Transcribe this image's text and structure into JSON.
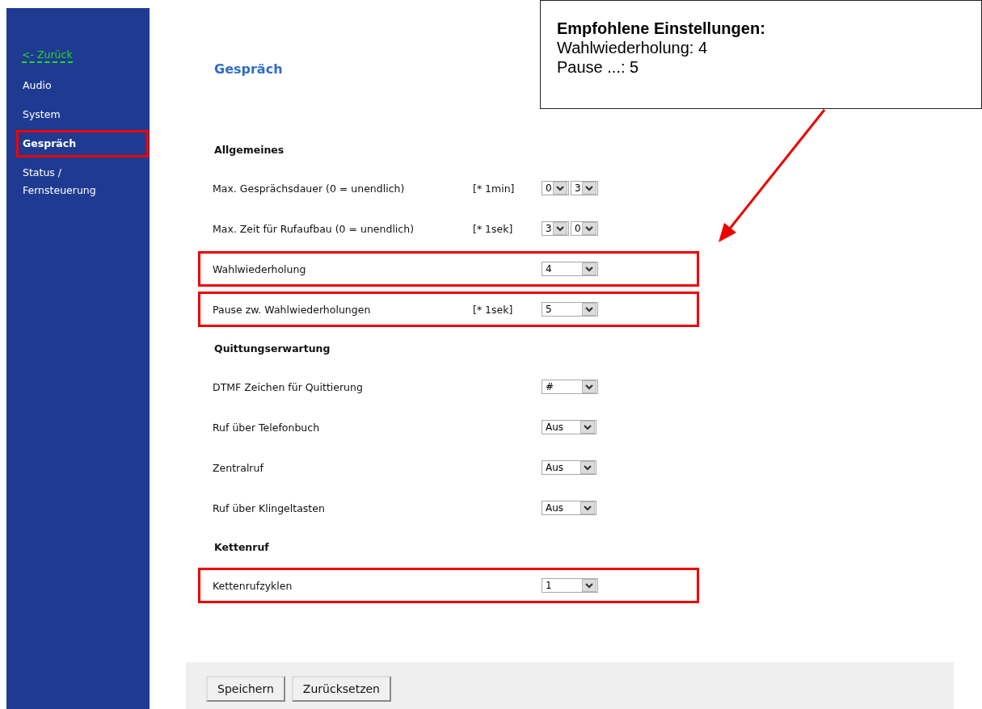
{
  "sidebar": {
    "back_link": "<- Zurück",
    "items": [
      {
        "label": "Audio",
        "selected": false,
        "highlighted": false
      },
      {
        "label": "System",
        "selected": false,
        "highlighted": false
      },
      {
        "label": "Gespräch",
        "selected": true,
        "highlighted": true
      },
      {
        "label": "Status /\nFernsteuerung",
        "selected": false,
        "highlighted": false
      }
    ]
  },
  "page_title": "Gespräch",
  "sections": [
    {
      "title": "Allgemeines",
      "rows": [
        {
          "label": "Max. Gesprächsdauer (0 = unendlich)",
          "unit": "[* 1min]",
          "selects": [
            "0",
            "3"
          ],
          "highlighted": false
        },
        {
          "label": "Max. Zeit für Rufaufbau (0 = unendlich)",
          "unit": "[* 1sek]",
          "selects": [
            "3",
            "0"
          ],
          "highlighted": false
        },
        {
          "label": "Wahlwiederholung",
          "selects": [
            "4"
          ],
          "highlighted": true
        },
        {
          "label": "Pause zw. Wahlwiederholungen",
          "unit": "[* 1sek]",
          "selects": [
            "5"
          ],
          "highlighted": true
        }
      ]
    },
    {
      "title": "Quittungserwartung",
      "rows": [
        {
          "label": "DTMF Zeichen für Quittierung",
          "selects": [
            "#"
          ],
          "highlighted": false
        },
        {
          "label": "Ruf über Telefonbuch",
          "selects": [
            "Aus"
          ],
          "highlighted": false
        },
        {
          "label": "Zentralruf",
          "selects": [
            "Aus"
          ],
          "highlighted": false
        },
        {
          "label": "Ruf über Klingeltasten",
          "selects": [
            "Aus"
          ],
          "highlighted": false
        }
      ]
    },
    {
      "title": "Kettenruf",
      "rows": [
        {
          "label": "Kettenrufzyklen",
          "selects": [
            "1"
          ],
          "highlighted": true
        }
      ]
    }
  ],
  "buttons": [
    "Speichern",
    "Zurücksetzen"
  ],
  "callout": {
    "title": "Empfohlene Einstellungen:",
    "lines": [
      "Wahlwiederholung: 4",
      "Pause ...: 5"
    ]
  }
}
